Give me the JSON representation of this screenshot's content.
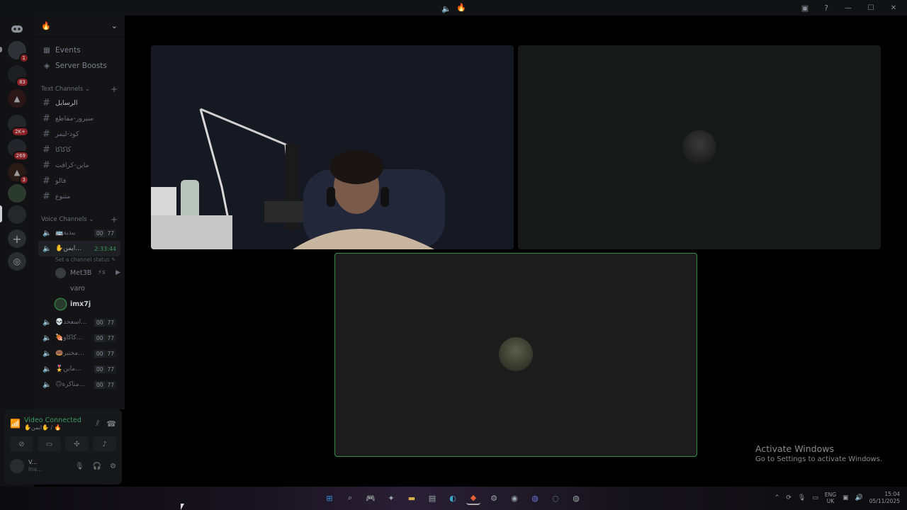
{
  "titlebar": {
    "title_icons": [
      "speaker-icon",
      "fire-icon"
    ],
    "title_emoji": "🔥"
  },
  "rail": {
    "badges": [
      "1",
      "83",
      "2K+",
      "269",
      "3"
    ]
  },
  "sidebar": {
    "server_emoji": "🔥",
    "menu": [
      {
        "label": "Events"
      },
      {
        "label": "Server Boosts"
      }
    ],
    "text_category": "Text Channels",
    "text_channels": [
      "الرسايل",
      "سيرور-مقاطع",
      "كود-ليمر",
      "كاكاكا",
      "ماين-كرافت",
      "فالو",
      "متنوع"
    ],
    "voice_category": "Voice Channels",
    "voice_channels": [
      {
        "name": "🚌يبدية",
        "a": "00",
        "b": "77"
      },
      {
        "name": "✋ايمن...",
        "timer": "2:33:44",
        "status": "Set a channel status"
      },
      {
        "name": "💀اسعحد...",
        "a": "00",
        "b": "77"
      },
      {
        "name": "🍖كاكاو...",
        "a": "00",
        "b": "77"
      },
      {
        "name": "🍩مختبر...",
        "a": "00",
        "b": "77"
      },
      {
        "name": "🎖️ماين...",
        "a": "00",
        "b": "77"
      },
      {
        "name": "🙃مناكرة...",
        "a": "00",
        "b": "77"
      }
    ],
    "members": [
      {
        "name": "Met3B",
        "extra": "⚡s"
      },
      {
        "name": "varo"
      },
      {
        "name": "imx7j"
      }
    ]
  },
  "panel": {
    "status": "Video Connected",
    "channel": "✋ايمن✋ / 🔥",
    "user_name": "V...",
    "user_status": "Inv..."
  },
  "watermark": {
    "line1": "Activate Windows",
    "line2": "Go to Settings to activate Windows."
  },
  "tray": {
    "lang1": "ENG",
    "lang2": "UK",
    "time": "15:04",
    "date": "05/11/2025"
  }
}
